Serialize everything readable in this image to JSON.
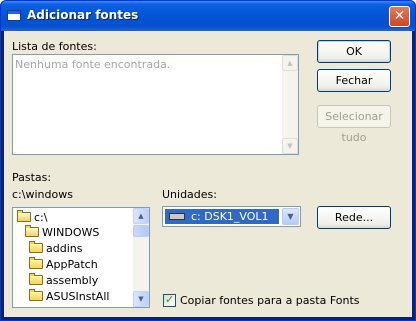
{
  "window": {
    "title": "Adicionar fontes",
    "close_glyph": "✕"
  },
  "fonts_list": {
    "label": "Lista de fontes:",
    "placeholder": "Nenhuma fonte encontrada."
  },
  "buttons": {
    "ok": "OK",
    "close": "Fechar",
    "select_all": "Selecionar tudo",
    "network": "Rede..."
  },
  "folders": {
    "label": "Pastas:",
    "current_path": "c:\\windows",
    "items": [
      {
        "name": "c:\\",
        "icon": "open-folder-icon"
      },
      {
        "name": "WINDOWS",
        "icon": "open-folder-icon"
      },
      {
        "name": "addins",
        "icon": "folder-icon"
      },
      {
        "name": "AppPatch",
        "icon": "folder-icon"
      },
      {
        "name": "assembly",
        "icon": "folder-icon"
      },
      {
        "name": "ASUSInstAll",
        "icon": "folder-icon"
      }
    ]
  },
  "drives": {
    "label": "Unidades:",
    "selected": "c: DSK1_VOL1",
    "icon": "hard-drive-icon"
  },
  "copy_option": {
    "label": "Copiar fontes para a pasta Fonts",
    "checked": true
  },
  "colors": {
    "title_bar": "#0454d6",
    "dialog_bg": "#ece9d8",
    "selection": "#316ac5"
  }
}
